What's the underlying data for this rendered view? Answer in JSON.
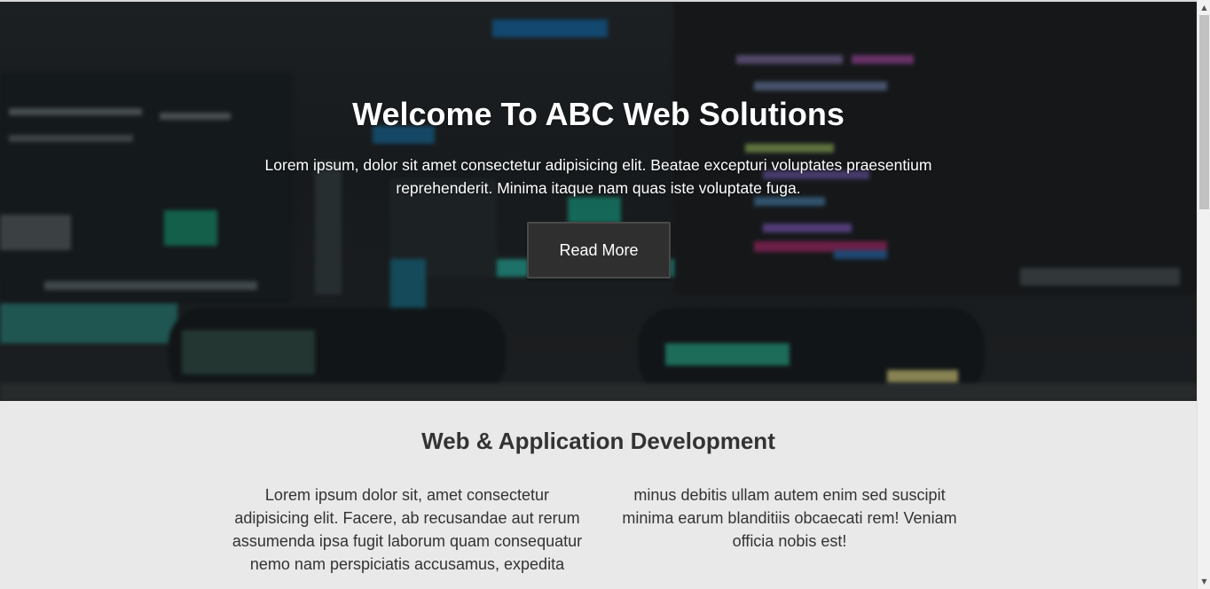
{
  "hero": {
    "title": "Welcome To ABC Web Solutions",
    "text": "Lorem ipsum, dolor sit amet consectetur adipisicing elit. Beatae excepturi voluptates praesentium reprehenderit. Minima itaque nam quas iste voluptate fuga.",
    "button_label": "Read More"
  },
  "section": {
    "title": "Web & Application Development",
    "col_left": "Lorem ipsum dolor sit, amet consectetur adipisicing elit. Facere, ab recusandae aut rerum assumenda ipsa fugit laborum quam consequatur nemo nam perspiciatis accusamus, expedita",
    "col_right": "minus debitis ullam autem enim sed suscipit minima earum blanditiis obcaecati rem! Veniam officia nobis est!"
  },
  "scrollbar": {
    "up_icon": "▲",
    "down_icon": "▼"
  },
  "colors": {
    "hero_button_bg": "#2f2f2f",
    "section_bg": "#e9e9e9",
    "text_dark": "#333333"
  }
}
